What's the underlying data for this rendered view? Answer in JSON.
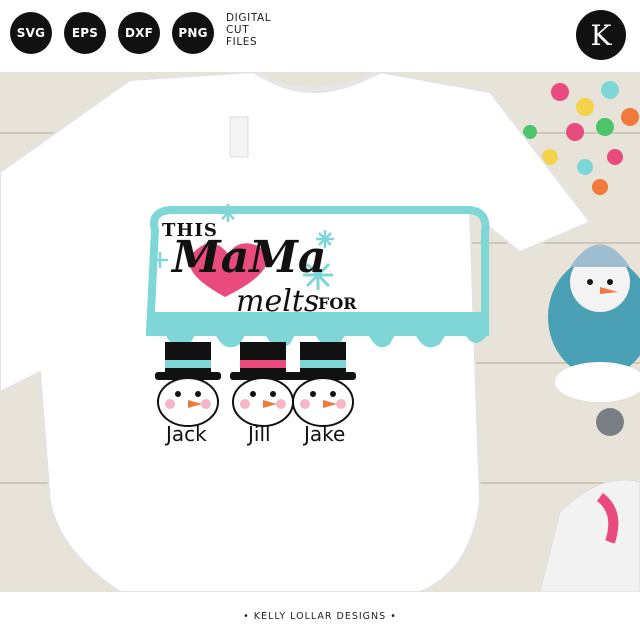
{
  "badges": [
    "SVG",
    "EPS",
    "DXF",
    "PNG"
  ],
  "digital_label": [
    "DIGITAL",
    "CUT",
    "FILES"
  ],
  "logo_letter": "K",
  "design": {
    "line1": "THIS",
    "line2": "MaMa",
    "line3": "melts",
    "line4": "FOR",
    "names": [
      "Jack",
      "Jill",
      "Jake"
    ]
  },
  "footer": "• KELLY LOLLAR DESIGNS •",
  "colors": {
    "aqua": "#7ed6d6",
    "pink": "#e94b7e",
    "ink": "#111111",
    "carrot": "#f07a3c"
  }
}
